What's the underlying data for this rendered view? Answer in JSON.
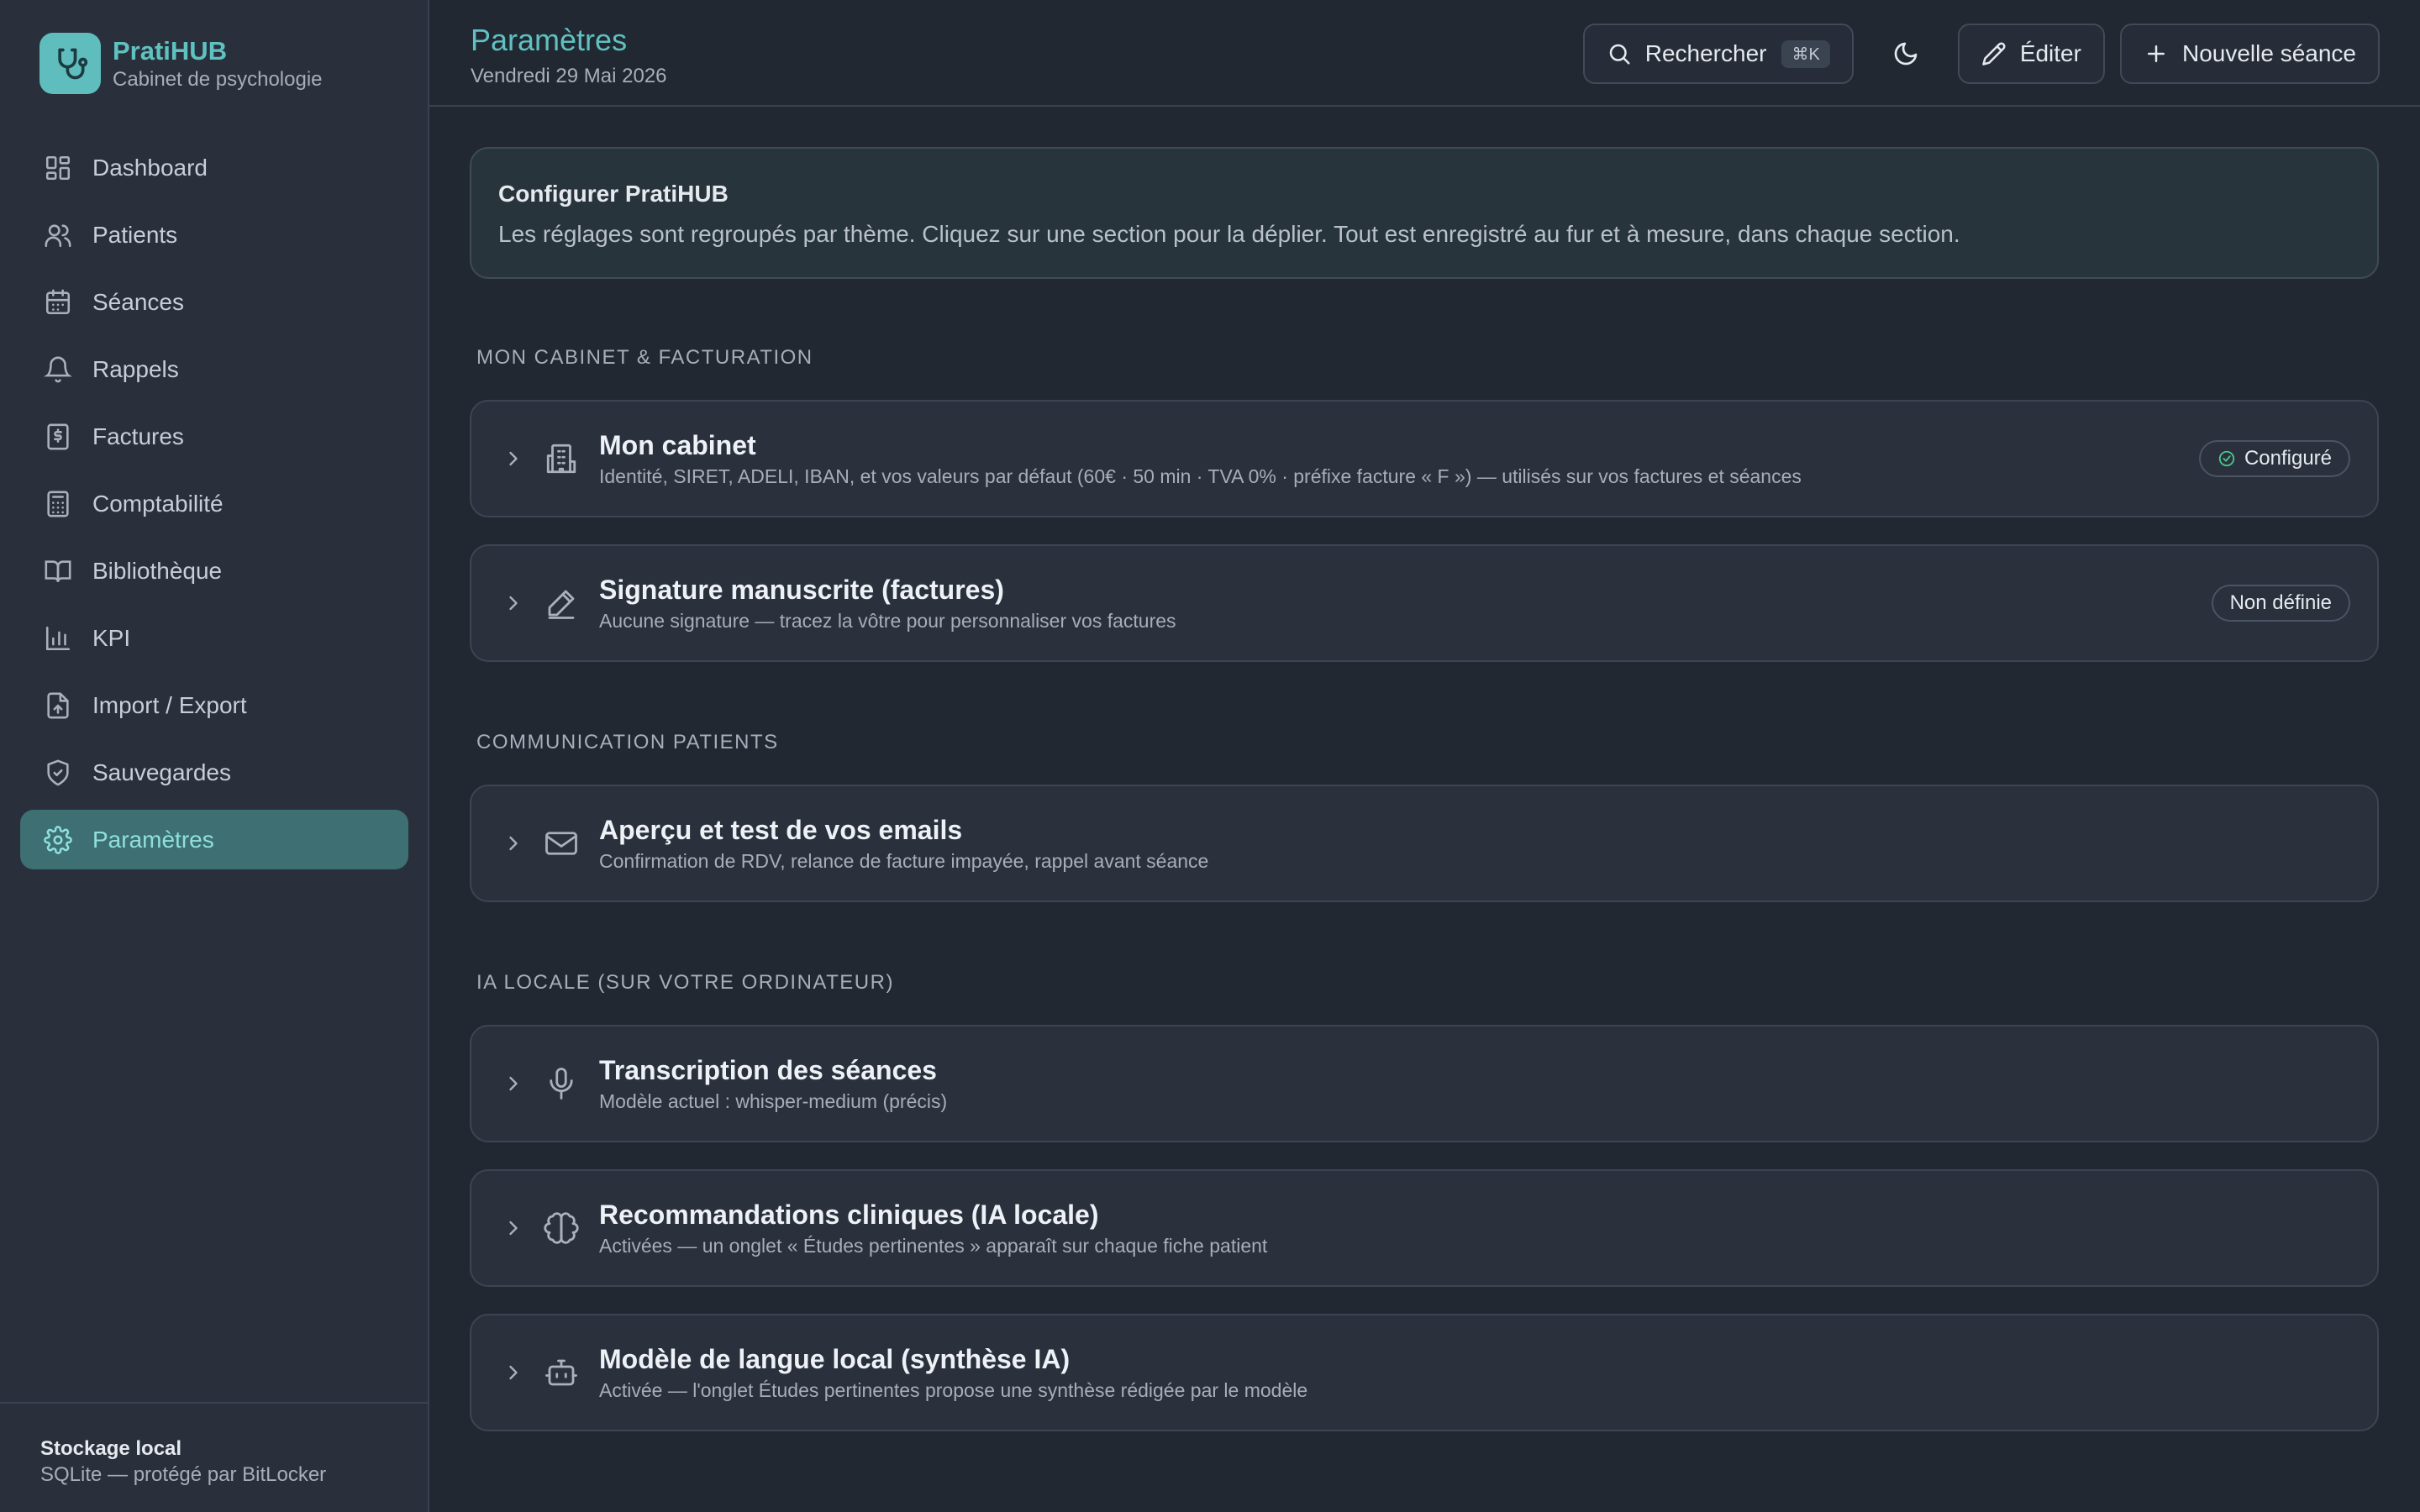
{
  "brand": {
    "name": "PratiHUB",
    "subtitle": "Cabinet de psychologie",
    "accent": "#5fc1c0"
  },
  "nav": {
    "items": [
      {
        "label": "Dashboard",
        "icon": "dashboard-icon"
      },
      {
        "label": "Patients",
        "icon": "users-icon"
      },
      {
        "label": "Séances",
        "icon": "calendar-icon"
      },
      {
        "label": "Rappels",
        "icon": "bell-icon"
      },
      {
        "label": "Factures",
        "icon": "invoice-icon"
      },
      {
        "label": "Comptabilité",
        "icon": "calculator-icon"
      },
      {
        "label": "Bibliothèque",
        "icon": "book-icon"
      },
      {
        "label": "KPI",
        "icon": "bar-chart-icon"
      },
      {
        "label": "Import / Export",
        "icon": "file-upload-icon"
      },
      {
        "label": "Sauvegardes",
        "icon": "shield-icon"
      },
      {
        "label": "Paramètres",
        "icon": "gear-icon",
        "active": true
      }
    ]
  },
  "storage": {
    "title": "Stockage local",
    "subtitle": "SQLite — protégé par BitLocker"
  },
  "header": {
    "title": "Paramètres",
    "date": "Vendredi 29 Mai 2026",
    "search_label": "Rechercher",
    "search_shortcut": "⌘K",
    "edit_label": "Éditer",
    "new_session_label": "Nouvelle séance"
  },
  "intro": {
    "title": "Configurer PratiHUB",
    "text": "Les réglages sont regroupés par thème. Cliquez sur une section pour la déplier. Tout est enregistré au fur et à mesure, dans chaque section."
  },
  "sections": {
    "cabinet": {
      "label": "MON CABINET & FACTURATION",
      "cards": [
        {
          "title": "Mon cabinet",
          "subtitle": "Identité, SIRET, ADELI, IBAN, et vos valeurs par défaut (60€ · 50 min · TVA 0% · préfixe facture « F ») — utilisés sur vos factures et séances",
          "badge": "Configuré"
        },
        {
          "title": "Signature manuscrite (factures)",
          "subtitle": "Aucune signature — tracez la vôtre pour personnaliser vos factures",
          "badge": "Non définie"
        }
      ]
    },
    "communication": {
      "label": "COMMUNICATION PATIENTS",
      "cards": [
        {
          "title": "Aperçu et test de vos emails",
          "subtitle": "Confirmation de RDV, relance de facture impayée, rappel avant séance"
        }
      ]
    },
    "ia": {
      "label": "IA LOCALE (SUR VOTRE ORDINATEUR)",
      "cards": [
        {
          "title": "Transcription des séances",
          "subtitle": "Modèle actuel : whisper-medium (précis)"
        },
        {
          "title": "Recommandations cliniques (IA locale)",
          "subtitle": "Activées — un onglet « Études pertinentes » apparaît sur chaque fiche patient"
        },
        {
          "title": "Modèle de langue local (synthèse IA)",
          "subtitle": "Activée — l'onglet Études pertinentes propose une synthèse rédigée par le modèle"
        }
      ]
    }
  }
}
